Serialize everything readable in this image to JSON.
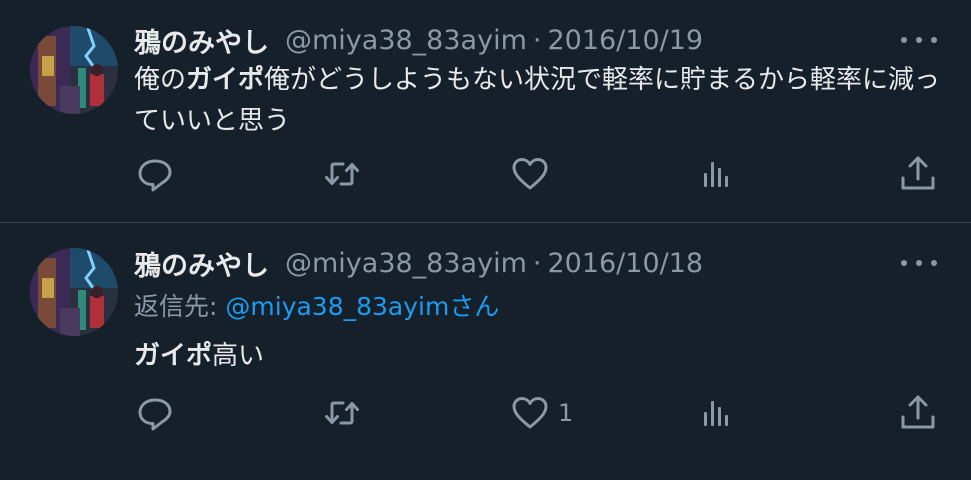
{
  "tweets": [
    {
      "name": "鴉のみやし",
      "handle": "@miya38_83ayim",
      "separator": "·",
      "date": "2016/10/19",
      "text_before": "俺の",
      "text_bold": "ガイポ",
      "text_after": "俺がどうしようもない状況で軽率に貯まるから軽率に減っていいと思う",
      "likes": ""
    },
    {
      "name": "鴉のみやし",
      "handle": "@miya38_83ayim",
      "separator": "·",
      "date": "2016/10/18",
      "reply_prefix": "返信先:",
      "reply_mention": "@miya38_83ayim",
      "reply_suffix": "さん",
      "text_bold": "ガイポ",
      "text_after": "高い",
      "likes": "1"
    }
  ],
  "icons": {
    "avatar": "avatar-image",
    "reply": "reply-icon",
    "retweet": "retweet-icon",
    "like": "heart-icon",
    "views": "views-icon",
    "share": "share-icon",
    "more": "more-icon"
  },
  "colors": {
    "background": "#15202b",
    "text": "#e7e9ea",
    "secondary": "#8b98a5",
    "link": "#1d9bf0",
    "divider": "#38444d"
  }
}
